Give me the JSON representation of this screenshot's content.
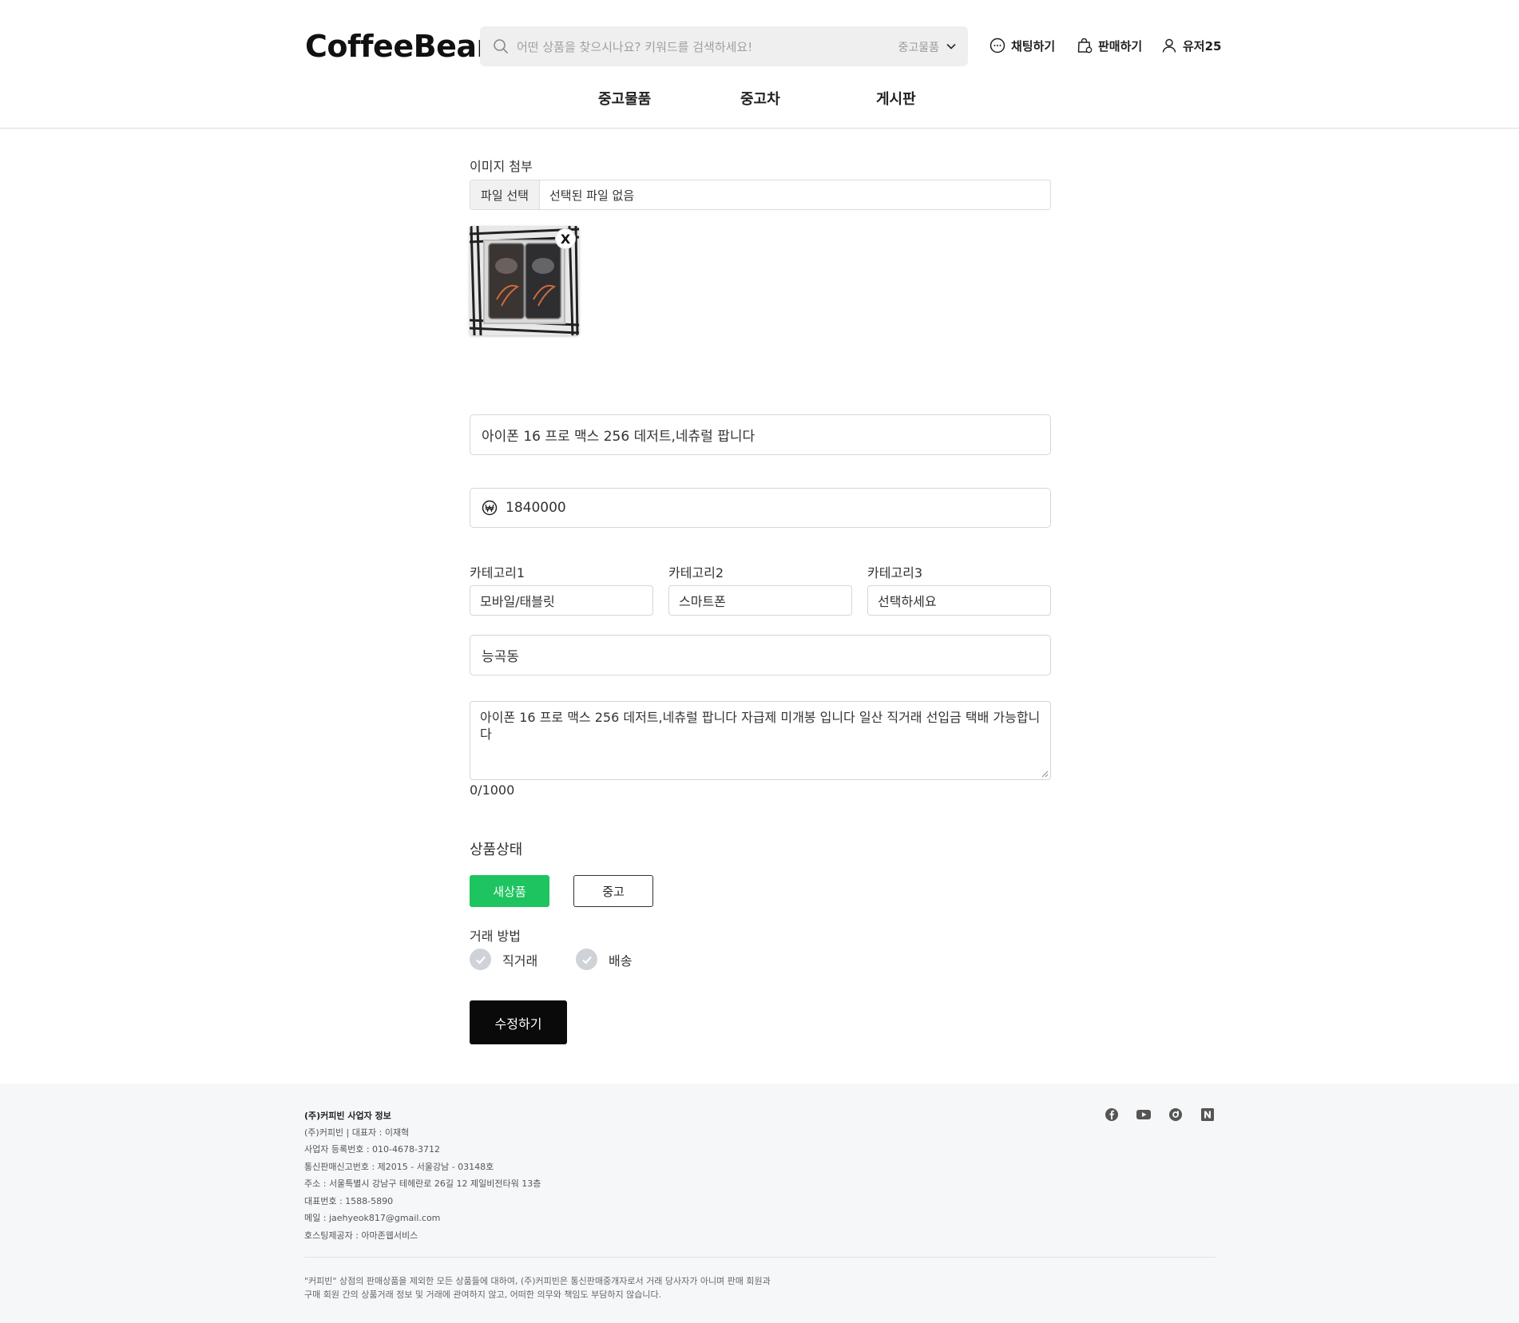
{
  "header": {
    "logo": "CoffeeBean",
    "search_placeholder": "어떤 상품을 찾으시나요? 키워드를 검색하세요!",
    "search_category": "중고물품",
    "chat_label": "채팅하기",
    "sell_label": "판매하기",
    "user_label": "유저25"
  },
  "nav": {
    "items": [
      "중고물품",
      "중고차",
      "게시판"
    ]
  },
  "form": {
    "image_label": "이미지 첨부",
    "file_button": "파일 선택",
    "file_status": "선택된 파일 없음",
    "thumb_remove": "X",
    "title_value": "아이폰 16 프로 맥스 256 데저트,네츄럴 팝니다",
    "price_value": "1840000",
    "categories": [
      {
        "label": "카테고리1",
        "value": "모바일/태블릿"
      },
      {
        "label": "카테고리2",
        "value": "스마트폰"
      },
      {
        "label": "카테고리3",
        "value": "선택하세요"
      }
    ],
    "location_value": "능곡동",
    "description_value": "아이폰 16 프로 맥스 256 데저트,네츄럴 팝니다 자급제 미개봉 입니다 일산 직거래 선입금 택배 가능합니다",
    "char_count": "0/1000",
    "condition_label": "상품상태",
    "condition_new": "새상품",
    "condition_used": "중고",
    "trade_label": "거래 방법",
    "trade_direct": "직거래",
    "trade_delivery": "배송",
    "submit_label": "수정하기"
  },
  "colors": {
    "accent_green": "#1ec45f",
    "submit_black": "#0a0a0a"
  },
  "footer": {
    "title": "(주)커피빈 사업자 정보",
    "lines": [
      "(주)커피빈 | 대표자 : 이재혁",
      "사업자 등록번호 : 010-4678-3712",
      "통신판매신고번호 : 제2015 - 서울강남 - 03148호",
      "주소 : 서울특별시 강남구 테헤란로 26길 12 제일비전타워 13층",
      "대표번호 : 1588-5890",
      "메일 : jaehyeok817@gmail.com",
      "호스팅제공자 : 아마존웹서비스"
    ],
    "notice_1": "\"커피빈\" 상점의 판매상품을 제외한 모든 상품들에 대하여, (주)커피빈은 통신판매중개자로서 거래 당사자가 아니며 판매 회원과",
    "notice_2": "구매 회원 간의 상품거래 정보 및 거래에 관여하지 않고, 어떠한 의무와 책임도 부담하지 않습니다.",
    "social_icons": [
      "facebook-icon",
      "youtube-icon",
      "blog-icon",
      "naver-icon"
    ]
  }
}
